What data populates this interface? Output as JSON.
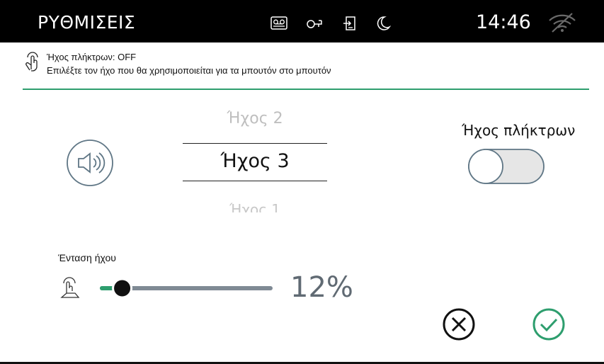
{
  "header": {
    "title": "ΡΥΘΜΙΣΕΙΣ",
    "time": "14:46",
    "status_icons": [
      "voicemail-icon",
      "key-icon",
      "door-exit-icon",
      "moon-icon"
    ],
    "wifi_icon": "wifi-off-icon"
  },
  "hint": {
    "icon": "touch-hand-icon",
    "line1": "Ήχος πλήκτρων: OFF",
    "line2": "Επιλέξτε τον ήχο που θα χρησιμοποιείται για τα μπουτόν στο μπουτόν"
  },
  "sound_picker": {
    "icon": "speaker-icon",
    "previous": "Ήχος 2",
    "selected": "Ήχος 3",
    "next": "Ήχος 1"
  },
  "key_sound_toggle": {
    "label": "Ήχος πλήκτρων",
    "state": "off"
  },
  "volume": {
    "label": "Ένταση ήχου",
    "icon": "touch-hand-icon",
    "value_percent": 12,
    "value_text": "12%"
  },
  "actions": {
    "cancel_icon": "close-circle-icon",
    "confirm_icon": "check-circle-icon"
  },
  "colors": {
    "accent": "#2e9e6e",
    "slider_track": "#7f8a94",
    "icon_grey": "#5f7685"
  }
}
